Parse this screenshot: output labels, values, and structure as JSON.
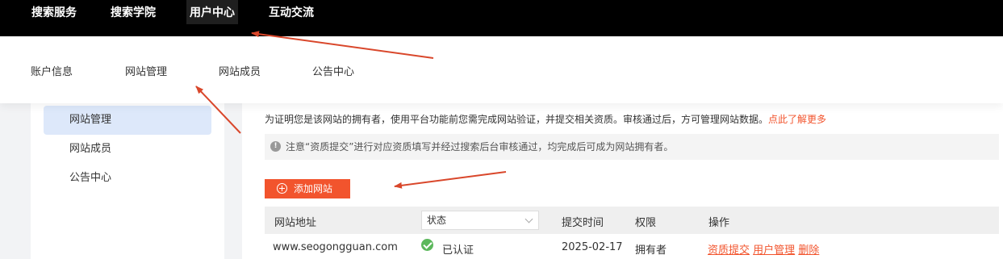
{
  "topnav": {
    "items": [
      "搜索服务",
      "搜索学院",
      "用户中心",
      "互动交流"
    ],
    "active": "用户中心"
  },
  "subnav": {
    "items": [
      "账户信息",
      "网站管理",
      "网站成员",
      "公告中心"
    ]
  },
  "sidebar": {
    "items": [
      "网站管理",
      "网站成员",
      "公告中心"
    ],
    "active": "网站管理"
  },
  "main": {
    "intro_text": "为证明您是该网站的拥有者，使用平台功能前您需完成网站验证，并提交相关资质。审核通过后，方可管理网站数据。",
    "intro_link": "点此了解更多",
    "notice_text": "注意“资质提交”进行对应资质填写并经过搜索后台审核通过，均完成后可成为网站拥有者。",
    "add_button": "添加网站",
    "table": {
      "headers": {
        "site": "网站地址",
        "status_select": "状态",
        "submit_time": "提交时间",
        "role": "权限",
        "actions": "操作"
      },
      "rows": [
        {
          "site": "www.seogongguan.com",
          "status": "已认证",
          "submit_time": "2025-02-17",
          "role": "拥有者",
          "actions": [
            "资质提交",
            "用户管理",
            "删除"
          ]
        }
      ]
    }
  },
  "colors": {
    "accent": "#f2542d",
    "topnav_bg": "#000000",
    "sidebar_active_bg": "#dde8fa",
    "annotation_arrow": "#d9472b",
    "verified_green": "#5cb85c"
  }
}
